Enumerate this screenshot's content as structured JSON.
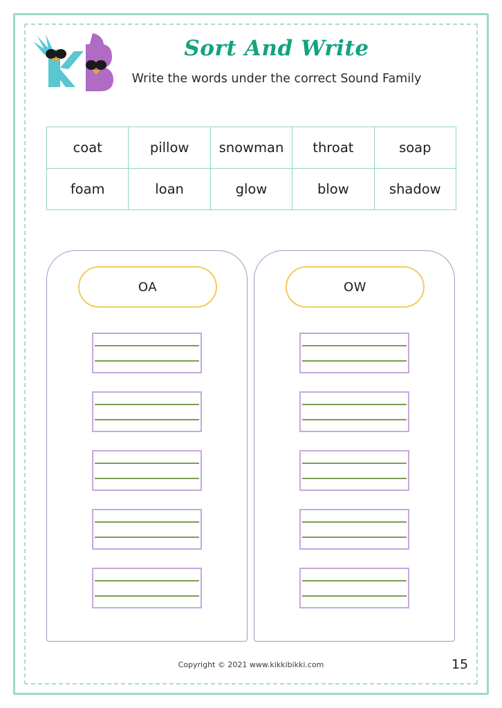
{
  "worksheet": {
    "title": "Sort And Write",
    "subtitle": "Write the words under the correct Sound Family",
    "logo_alt": "kikkibikki-bird-logo",
    "title_color": "#12a37f",
    "border_color": "#9ed9c8"
  },
  "word_bank": {
    "rows": [
      [
        "coat",
        "pillow",
        "snowman",
        "throat",
        "soap"
      ],
      [
        "foam",
        "loan",
        "glow",
        "blow",
        "shadow"
      ]
    ],
    "border_color": "#8fd4c1"
  },
  "sort_columns": [
    {
      "id": "oa",
      "label": "OA",
      "pill_color": "#f0cc5e",
      "container_color": "#9b9bc4",
      "line_count": 5,
      "answers": []
    },
    {
      "id": "ow",
      "label": "OW",
      "pill_color": "#f0cc5e",
      "container_color": "#9b9bc4",
      "line_count": 5,
      "answers": []
    }
  ],
  "write_line": {
    "box_color": "#c5a8dd",
    "mid_line_color": "#7a9e4f"
  },
  "footer": {
    "copyright": "Copyright © 2021 www.kikkibikki.com",
    "page_number": "15"
  }
}
